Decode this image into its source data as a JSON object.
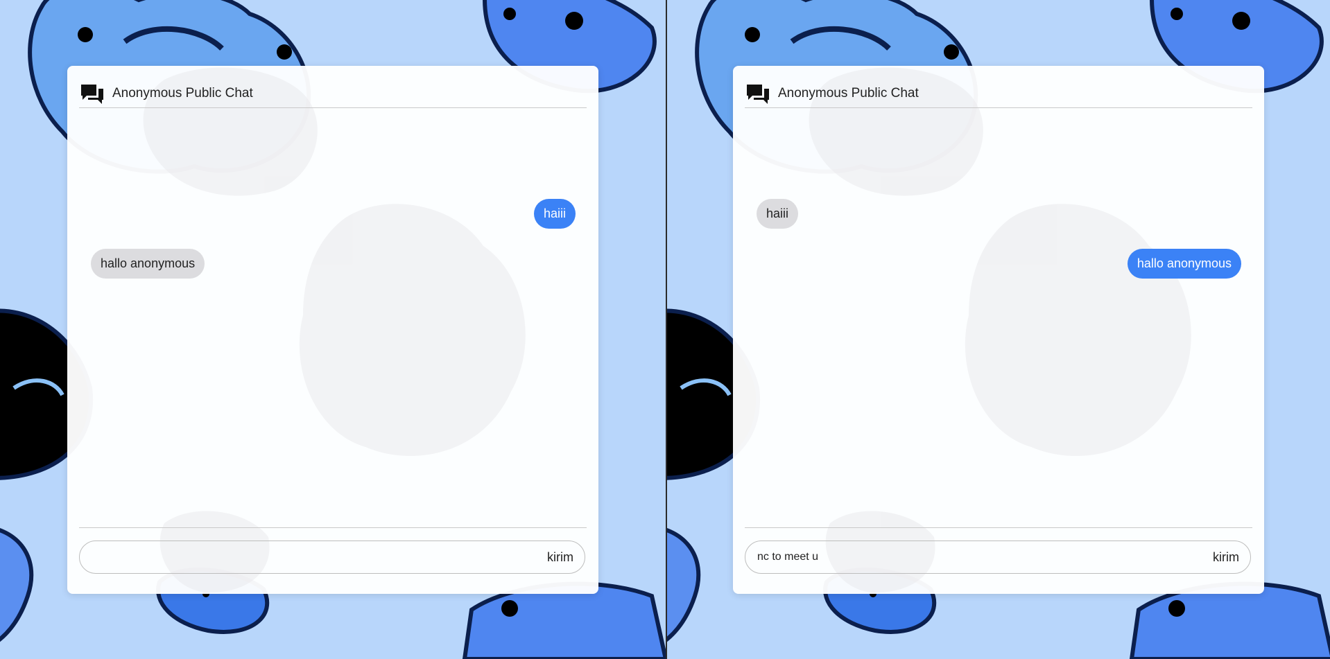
{
  "app": {
    "title": "Anonymous Public Chat"
  },
  "icons": {
    "header": "chat-bubbles-icon"
  },
  "colors": {
    "sent_bubble": "#3b82f6",
    "received_bubble": "#dcdcdf",
    "background": "#b8d6fb"
  },
  "panes": [
    {
      "messages": [
        {
          "text": "haiii",
          "direction": "sent"
        },
        {
          "text": "hallo anonymous",
          "direction": "received"
        }
      ],
      "input": {
        "value": "",
        "placeholder": ""
      },
      "send_label": "kirim"
    },
    {
      "messages": [
        {
          "text": "haiii",
          "direction": "received"
        },
        {
          "text": "hallo anonymous",
          "direction": "sent"
        }
      ],
      "input": {
        "value": "nc to meet u",
        "placeholder": ""
      },
      "send_label": "kirim"
    }
  ]
}
